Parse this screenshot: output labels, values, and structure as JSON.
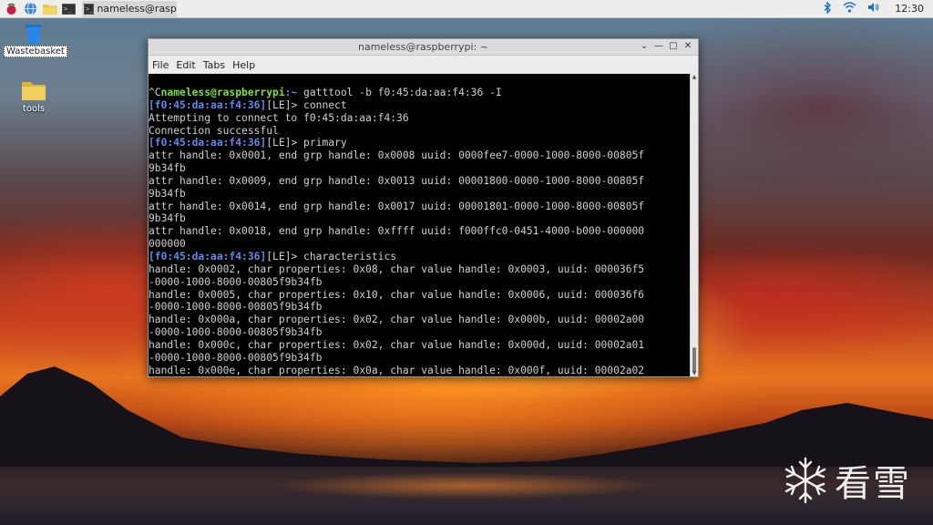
{
  "taskbar": {
    "icons": [
      "raspberry-icon",
      "globe-icon",
      "folder-icon",
      "terminal-icon"
    ],
    "active_task_label": "nameless@rasp...",
    "clock": "12:30"
  },
  "desktop": {
    "wastebasket_label": "Wastebasket",
    "tools_label": "tools"
  },
  "window": {
    "title": "nameless@raspberrypi: ~",
    "menu": [
      "File",
      "Edit",
      "Tabs",
      "Help"
    ]
  },
  "terminal": {
    "prompt_prefix": "^C",
    "prompt_user": "nameless@raspberrypi",
    "prompt_path": ":~",
    "command": " gatttool -b f0:45:da:aa:f4:36 -I",
    "lines": [
      {
        "p": "[f0:45:da:aa:f4:36]",
        "le": "[LE]>",
        "cmd": " connect"
      },
      {
        "text": "Attempting to connect to f0:45:da:aa:f4:36"
      },
      {
        "text": "Connection successful"
      },
      {
        "p": "[f0:45:da:aa:f4:36]",
        "le": "[LE]>",
        "cmd": " primary"
      },
      {
        "text": "attr handle: 0x0001, end grp handle: 0x0008 uuid: 0000fee7-0000-1000-8000-00805f"
      },
      {
        "text": "9b34fb"
      },
      {
        "text": "attr handle: 0x0009, end grp handle: 0x0013 uuid: 00001800-0000-1000-8000-00805f"
      },
      {
        "text": "9b34fb"
      },
      {
        "text": "attr handle: 0x0014, end grp handle: 0x0017 uuid: 00001801-0000-1000-8000-00805f"
      },
      {
        "text": "9b34fb"
      },
      {
        "text": "attr handle: 0x0018, end grp handle: 0xffff uuid: f000ffc0-0451-4000-b000-000000"
      },
      {
        "text": "000000"
      },
      {
        "p": "[f0:45:da:aa:f4:36]",
        "le": "[LE]>",
        "cmd": " characteristics"
      },
      {
        "text": "handle: 0x0002, char properties: 0x08, char value handle: 0x0003, uuid: 000036f5"
      },
      {
        "text": "-0000-1000-8000-00805f9b34fb"
      },
      {
        "text": "handle: 0x0005, char properties: 0x10, char value handle: 0x0006, uuid: 000036f6"
      },
      {
        "text": "-0000-1000-8000-00805f9b34fb"
      },
      {
        "text": "handle: 0x000a, char properties: 0x02, char value handle: 0x000b, uuid: 00002a00"
      },
      {
        "text": "-0000-1000-8000-00805f9b34fb"
      },
      {
        "text": "handle: 0x000c, char properties: 0x02, char value handle: 0x000d, uuid: 00002a01"
      },
      {
        "text": "-0000-1000-8000-00805f9b34fb"
      },
      {
        "text": "handle: 0x000e, char properties: 0x0a, char value handle: 0x000f, uuid: 00002a02"
      }
    ]
  },
  "watermark": {
    "text": "看雪",
    "icon": "snowflake-icon"
  },
  "colors": {
    "prompt_green": "#7ee03b",
    "prompt_blue": "#5c8be8",
    "terminal_bg": "#000000"
  }
}
